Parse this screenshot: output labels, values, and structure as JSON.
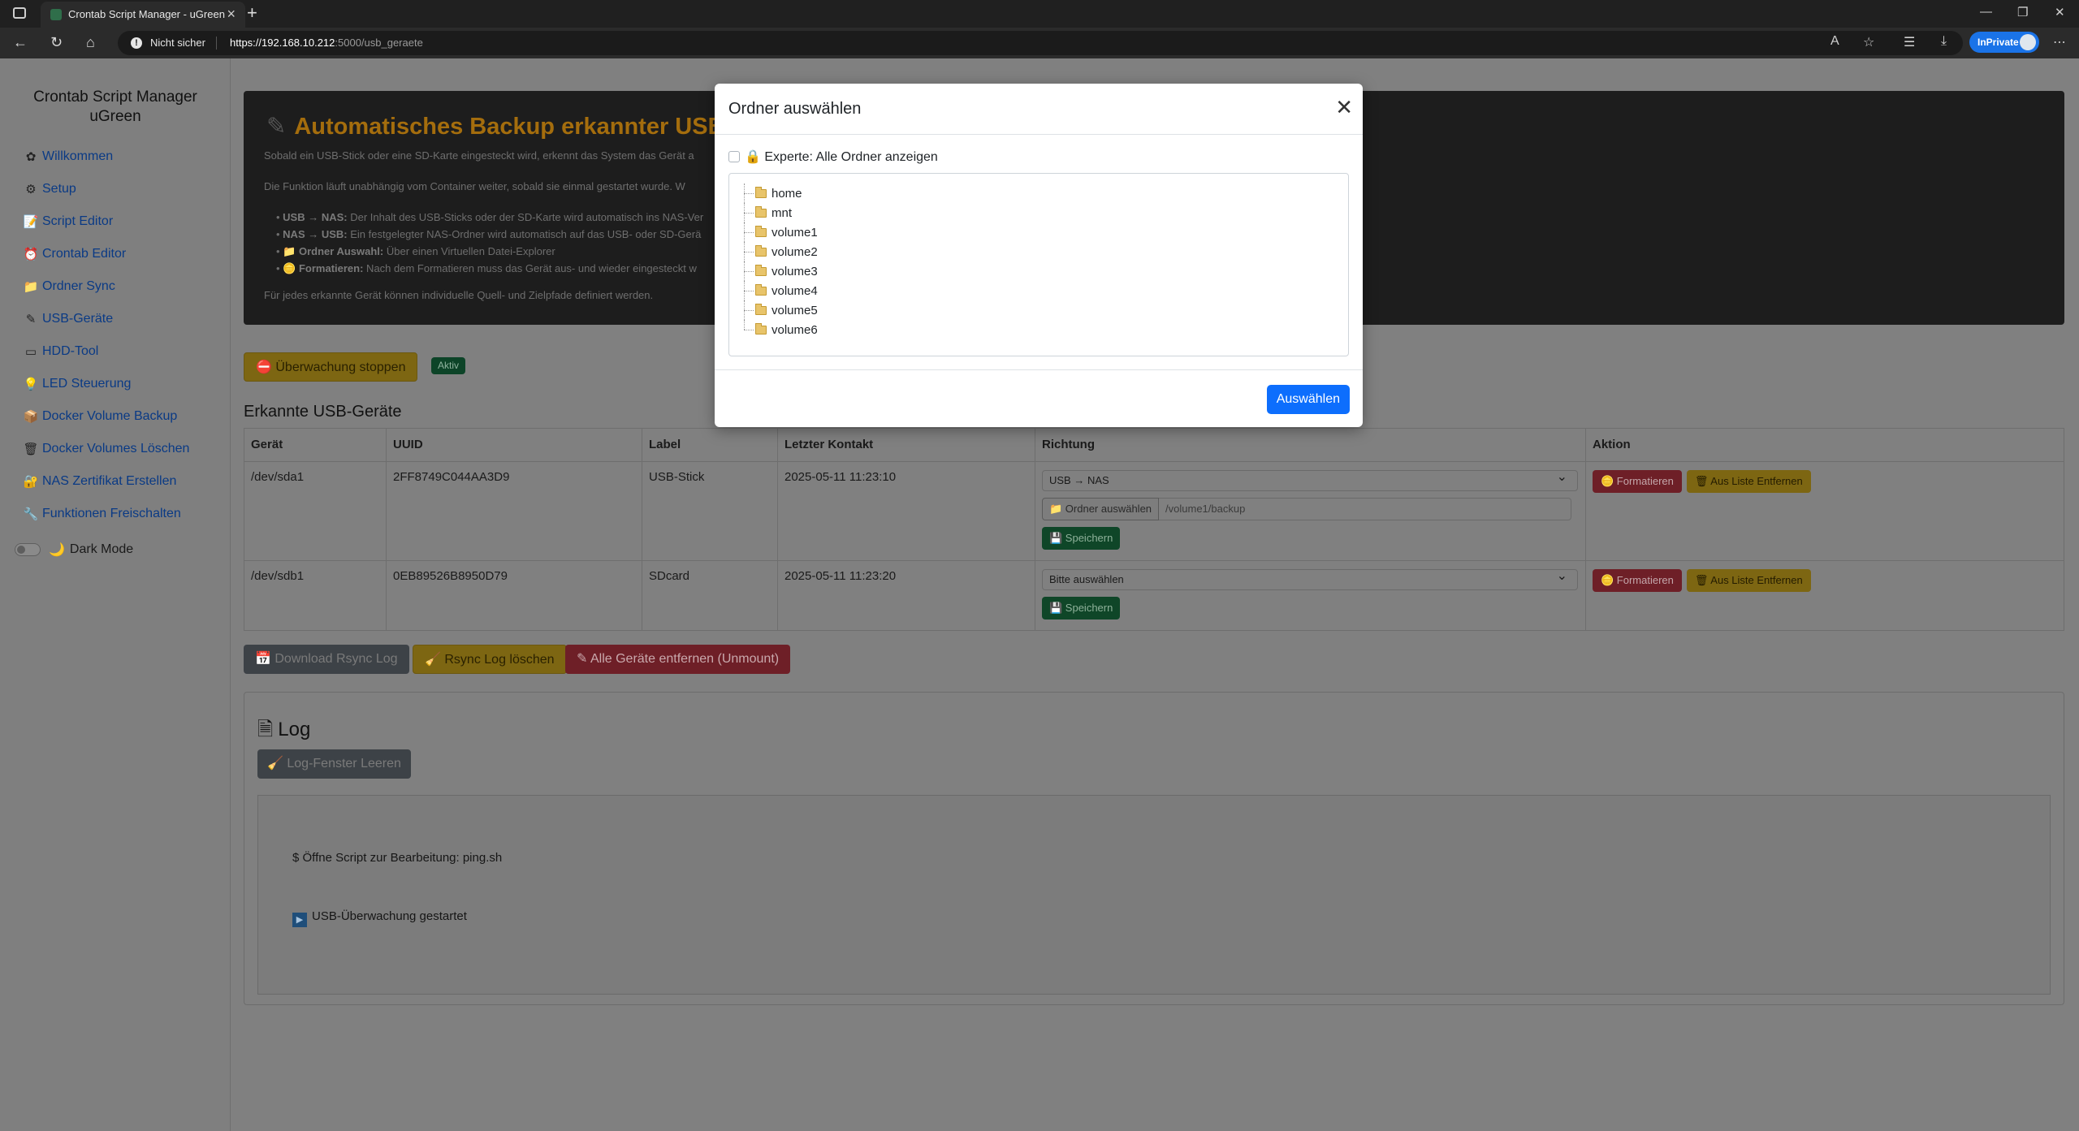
{
  "browser": {
    "tab_title": "Crontab Script Manager - uGreen",
    "security_label": "Nicht sicher",
    "url_host": "https://192.168.10.212",
    "url_path": ":5000/usb_geraete",
    "inprivate_label": "InPrivate"
  },
  "sidebar": {
    "brand": "Crontab Script Manager uGreen",
    "items": [
      {
        "label": "Willkommen",
        "icon": "✿"
      },
      {
        "label": "Setup",
        "icon": "⚙"
      },
      {
        "label": "Script Editor",
        "icon": "📝"
      },
      {
        "label": "Crontab Editor",
        "icon": "⏰"
      },
      {
        "label": "Ordner Sync",
        "icon": "📁"
      },
      {
        "label": "USB-Geräte",
        "icon": "✎"
      },
      {
        "label": "HDD-Tool",
        "icon": "▭"
      },
      {
        "label": "LED Steuerung",
        "icon": "💡"
      },
      {
        "label": "Docker Volume Backup",
        "icon": "📦"
      },
      {
        "label": "Docker Volumes Löschen",
        "icon": "🗑"
      },
      {
        "label": "NAS Zertifikat Erstellen",
        "icon": "🔐"
      },
      {
        "label": "Funktionen Freischalten",
        "icon": "🔧"
      }
    ],
    "dark_mode_label": "Dark Mode"
  },
  "hero": {
    "title": "Automatisches Backup erkannter USB- u",
    "p1": "Sobald ein USB-Stick oder eine SD-Karte eingesteckt wird, erkennt das System das Gerät a",
    "p2": "Die Funktion läuft unabhängig vom Container weiter, sobald sie einmal gestartet wurde. W",
    "bullets": [
      {
        "key": "USB → NAS:",
        "text": " Der Inhalt des USB-Sticks oder der SD-Karte wird automatisch ins NAS-Ver"
      },
      {
        "key": "NAS → USB:",
        "text": " Ein festgelegter NAS-Ordner wird automatisch auf das USB- oder SD-Gerä"
      },
      {
        "key": "📁 Ordner Auswahl:",
        "text": " Über einen Virtuellen Datei-Explorer"
      },
      {
        "key": "🪙 Formatieren:",
        "text": " Nach dem Formatieren muss das Gerät aus- und wieder eingesteckt w"
      }
    ],
    "p3": "Für jedes erkannte Gerät können individuelle Quell- und Zielpfade definiert werden."
  },
  "monitor": {
    "stop_label": "⛔ Überwachung stoppen",
    "status_badge": "Aktiv"
  },
  "devices": {
    "title": "Erkannte USB-Geräte",
    "headers": [
      "Gerät",
      "UUID",
      "Label",
      "Letzter Kontakt",
      "Richtung",
      "Aktion"
    ],
    "rows": [
      {
        "device": "/dev/sda1",
        "uuid": "2FF8749C044AA3D9",
        "label": "USB-Stick",
        "last_contact": "2025-05-11 11:23:10",
        "direction": "USB → NAS",
        "folder_btn": "📁 Ordner auswählen",
        "folder_value": "/volume1/backup",
        "save": "💾 Speichern",
        "format": "🪙 Formatieren",
        "remove": "🗑 Aus Liste Entfernen"
      },
      {
        "device": "/dev/sdb1",
        "uuid": "0EB89526B8950D79",
        "label": "SDcard",
        "last_contact": "2025-05-11 11:23:20",
        "direction": "Bitte auswählen",
        "save": "💾 Speichern",
        "format": "🪙 Formatieren",
        "remove": "🗑 Aus Liste Entfernen"
      }
    ]
  },
  "actions": {
    "download": "📅 Download Rsync Log",
    "clear_rsync": "🧹 Rsync Log löschen",
    "unmount_all": "✎ Alle Geräte entfernen (Unmount)"
  },
  "log": {
    "title": "Log",
    "clear_btn": "🧹 Log-Fenster Leeren",
    "lines": [
      "$ Öffne Script zur Bearbeitung: ping.sh",
      "USB-Überwachung gestartet"
    ]
  },
  "modal": {
    "title": "Ordner auswählen",
    "expert_label": "🔒 Experte: Alle Ordner anzeigen",
    "folders": [
      "home",
      "mnt",
      "volume1",
      "volume2",
      "volume3",
      "volume4",
      "volume5",
      "volume6"
    ],
    "select_btn": "Auswählen"
  }
}
